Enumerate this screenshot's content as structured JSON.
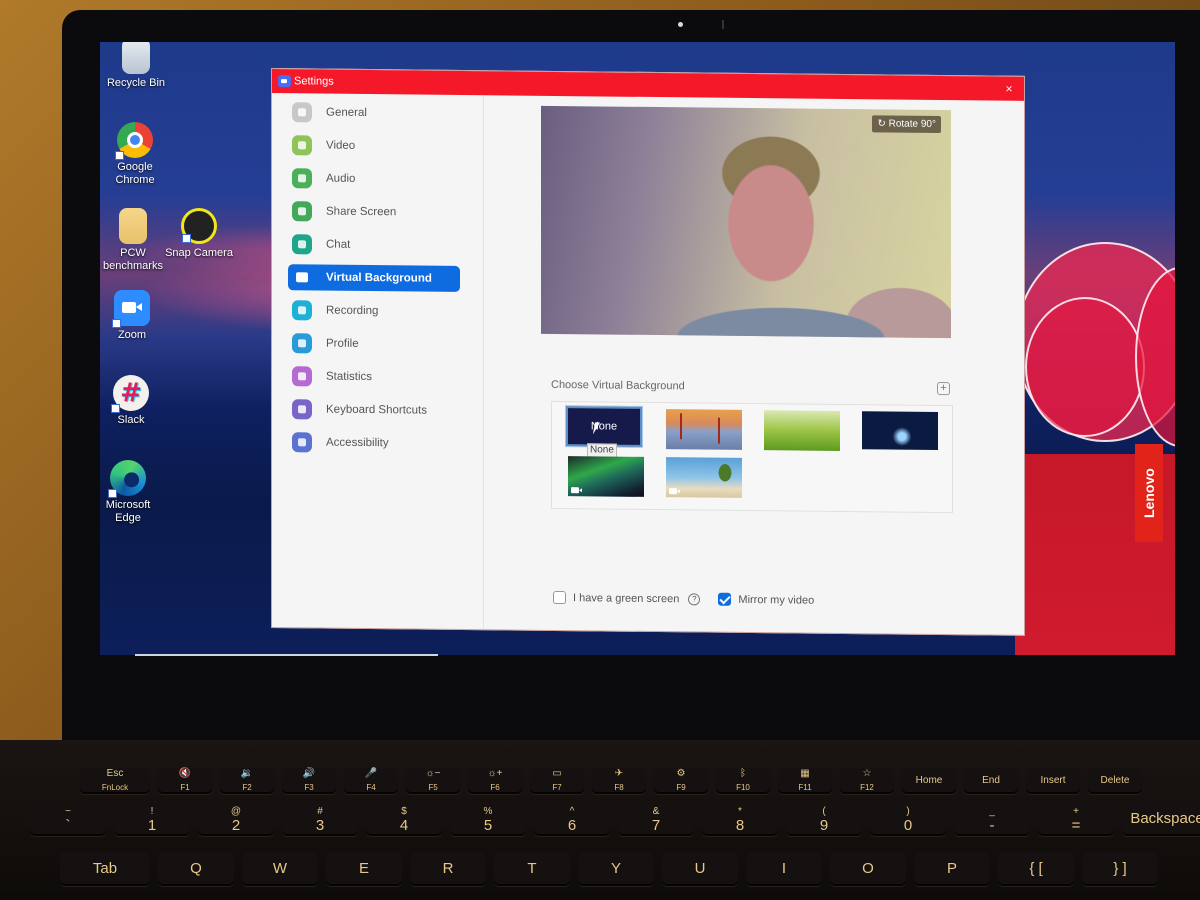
{
  "desktop": {
    "icons": [
      {
        "name": "recycle-bin",
        "label": "Recycle Bin"
      },
      {
        "name": "google-chrome",
        "label": "Google Chrome"
      },
      {
        "name": "pcw-benchmarks",
        "label": "PCW benchmarks"
      },
      {
        "name": "snap-camera",
        "label": "Snap Camera"
      },
      {
        "name": "zoom",
        "label": "Zoom"
      },
      {
        "name": "slack",
        "label": "Slack"
      },
      {
        "name": "microsoft-edge",
        "label": "Microsoft Edge"
      }
    ],
    "brand_badge": "Lenovo"
  },
  "window": {
    "title": "Settings",
    "close_glyph": "×",
    "titlebar_color": "#f51829"
  },
  "sidebar": {
    "active_color": "#0e6ce0",
    "items": [
      {
        "label": "General",
        "icon": "gear-icon",
        "color": "#c8c8c8",
        "active": false
      },
      {
        "label": "Video",
        "icon": "video-icon",
        "color": "#8fc45a",
        "active": false
      },
      {
        "label": "Audio",
        "icon": "headphones-icon",
        "color": "#4cb05a",
        "active": false
      },
      {
        "label": "Share Screen",
        "icon": "share-screen-icon",
        "color": "#43a85a",
        "active": false
      },
      {
        "label": "Chat",
        "icon": "chat-icon",
        "color": "#1fa68a",
        "active": false
      },
      {
        "label": "Virtual Background",
        "icon": "virtual-background-icon",
        "color": "#0e6ce0",
        "active": true
      },
      {
        "label": "Recording",
        "icon": "recording-icon",
        "color": "#1fb0d8",
        "active": false
      },
      {
        "label": "Profile",
        "icon": "profile-icon",
        "color": "#2a9ad8",
        "active": false
      },
      {
        "label": "Statistics",
        "icon": "statistics-icon",
        "color": "#b46ad0",
        "active": false
      },
      {
        "label": "Keyboard Shortcuts",
        "icon": "keyboard-icon",
        "color": "#7a64c8",
        "active": false
      },
      {
        "label": "Accessibility",
        "icon": "accessibility-icon",
        "color": "#5a72d0",
        "active": false
      }
    ]
  },
  "main": {
    "rotate_label": "Rotate 90°",
    "choose_label": "Choose Virtual Background",
    "add_glyph": "+",
    "backgrounds": [
      {
        "name": "none",
        "label": "None",
        "selected": true,
        "video": false
      },
      {
        "name": "golden-gate-bridge",
        "label": "",
        "selected": false,
        "video": false
      },
      {
        "name": "grass",
        "label": "",
        "selected": false,
        "video": false
      },
      {
        "name": "earth-from-space",
        "label": "",
        "selected": false,
        "video": false
      },
      {
        "name": "northern-lights",
        "label": "",
        "selected": false,
        "video": true
      },
      {
        "name": "beach",
        "label": "",
        "selected": false,
        "video": true
      }
    ],
    "tooltip": "None",
    "green_screen_label": "I have a green screen",
    "green_screen_checked": false,
    "help_glyph": "?",
    "mirror_label": "Mirror my video",
    "mirror_checked": true
  },
  "keyboard": {
    "fn_row": [
      {
        "top": "Esc",
        "bottom": "FnLock"
      },
      {
        "top": "🔇",
        "bottom": "F1"
      },
      {
        "top": "🔉",
        "bottom": "F2"
      },
      {
        "top": "🔊",
        "bottom": "F3"
      },
      {
        "top": "🎤",
        "bottom": "F4"
      },
      {
        "top": "☼−",
        "bottom": "F5"
      },
      {
        "top": "☼+",
        "bottom": "F6"
      },
      {
        "top": "▭",
        "bottom": "F7"
      },
      {
        "top": "✈",
        "bottom": "F8"
      },
      {
        "top": "⚙",
        "bottom": "F9"
      },
      {
        "top": "ᛒ",
        "bottom": "F10"
      },
      {
        "top": "▦",
        "bottom": "F11"
      },
      {
        "top": "☆",
        "bottom": "F12"
      },
      {
        "top": "Home",
        "bottom": ""
      },
      {
        "top": "End",
        "bottom": ""
      },
      {
        "top": "Insert",
        "bottom": ""
      },
      {
        "top": "Delete",
        "bottom": ""
      }
    ],
    "num_row": [
      {
        "top": "~",
        "bottom": "`"
      },
      {
        "top": "!",
        "bottom": "1"
      },
      {
        "top": "@",
        "bottom": "2"
      },
      {
        "top": "#",
        "bottom": "3"
      },
      {
        "top": "$",
        "bottom": "4"
      },
      {
        "top": "%",
        "bottom": "5"
      },
      {
        "top": "^",
        "bottom": "6"
      },
      {
        "top": "&",
        "bottom": "7"
      },
      {
        "top": "*",
        "bottom": "8"
      },
      {
        "top": "(",
        "bottom": "9"
      },
      {
        "top": ")",
        "bottom": "0"
      },
      {
        "top": "_",
        "bottom": "-"
      },
      {
        "top": "+",
        "bottom": "="
      },
      {
        "top": "",
        "bottom": "Backspace"
      }
    ],
    "letter_row": [
      "Tab",
      "Q",
      "W",
      "E",
      "R",
      "T",
      "Y",
      "U",
      "I",
      "O",
      "P",
      "{ [",
      "} ]"
    ]
  }
}
